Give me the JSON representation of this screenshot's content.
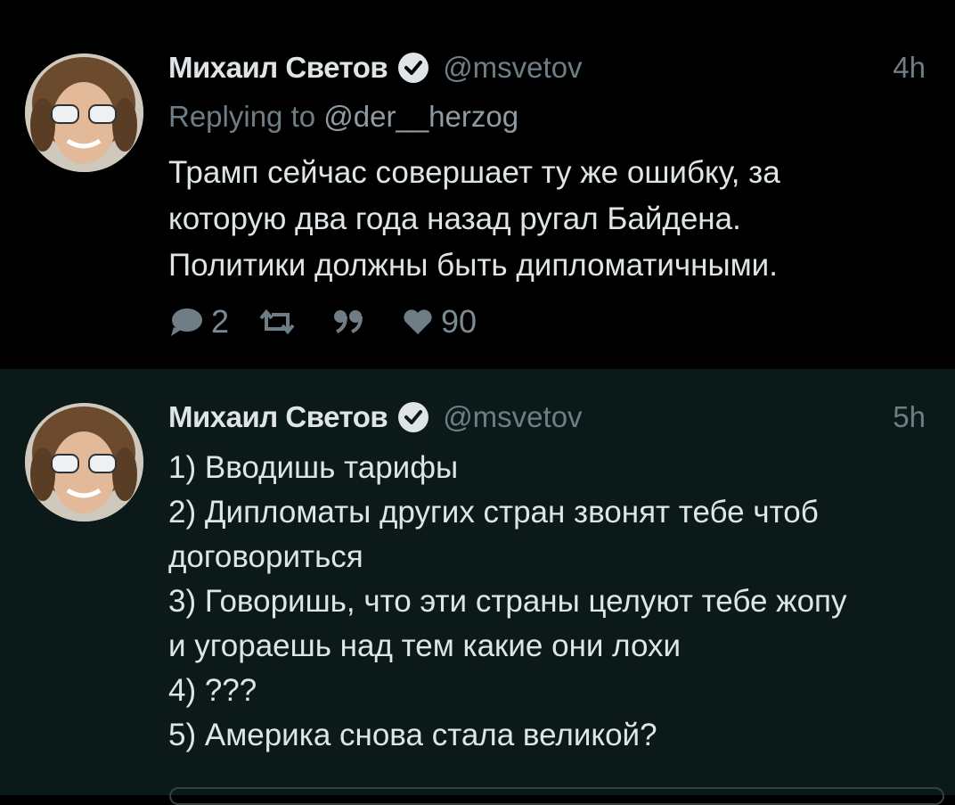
{
  "tweets": [
    {
      "author": {
        "name": "Михаил Светов",
        "handle": "@msvetov",
        "verified": true
      },
      "time": "4h",
      "reply_prefix": "Replying to ",
      "reply_to": "@der__herzog",
      "lines": [
        "Трамп сейчас совершает ту же ошибку, за",
        "которую два года назад ругал Байдена.",
        "Политики должны быть дипломатичными."
      ],
      "actions": {
        "replies": "2",
        "retweets": "",
        "quotes": "",
        "likes": "90"
      }
    },
    {
      "author": {
        "name": "Михаил Светов",
        "handle": "@msvetov",
        "verified": true
      },
      "time": "5h",
      "lines": [
        "1) Вводишь тарифы",
        "2) Дипломаты других стран звонят тебе чтоб",
        "договориться",
        "3) Говоришь, что эти страны целуют тебе жопу",
        "и угораешь над тем какие они лохи",
        "4) ???",
        "5) Америка снова стала великой?"
      ]
    }
  ],
  "colors": {
    "background": "#000000",
    "second_tweet_bg": "#0b1a18",
    "text": "#dfe4e6",
    "muted": "#6f7d86"
  }
}
